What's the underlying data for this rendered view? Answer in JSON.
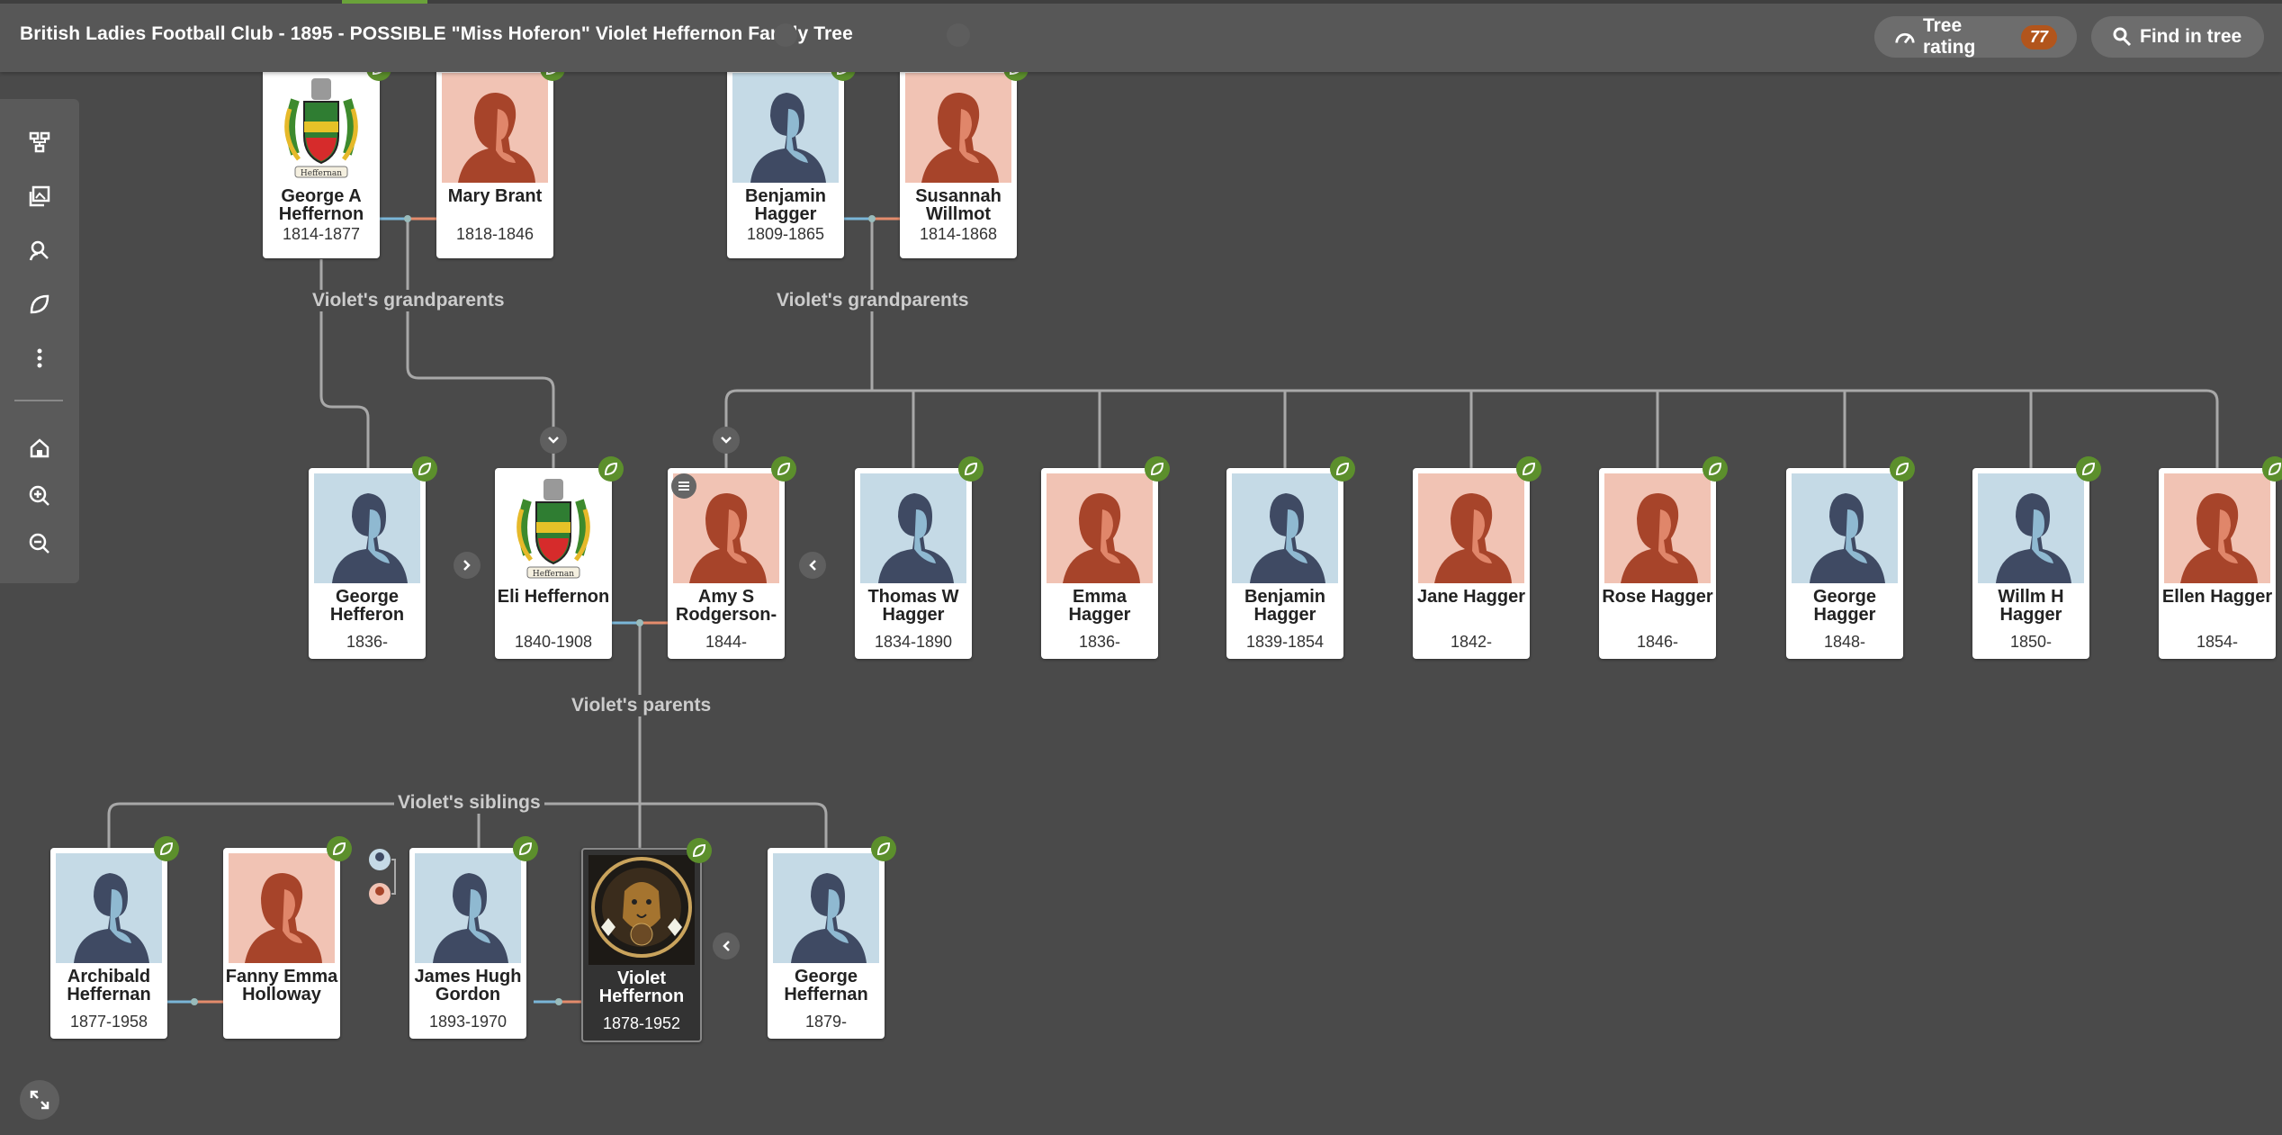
{
  "header": {
    "title": "British Ladies Football Club - 1895 - POSSIBLE \"Miss Hoferon\" Violet Heffernon Family Tree",
    "rating_label": "Tree rating",
    "rating_value": "77",
    "find_label": "Find in tree"
  },
  "toolbar": {
    "icons": [
      "tree-view-icon",
      "gallery-icon",
      "search-person-icon",
      "hint-icon",
      "more-icon",
      "home-icon",
      "zoom-in-icon",
      "zoom-out-icon"
    ]
  },
  "labels": {
    "grandparents_left": "Violet's grandparents",
    "grandparents_right": "Violet's grandparents",
    "parents": "Violet's parents",
    "siblings": "Violet's siblings"
  },
  "colors": {
    "male_bg": "#c5dae6",
    "male_fg": "#3f4a63",
    "female_bg": "#f1c3b4",
    "female_fg": "#a7442a",
    "leaf": "#5c8f2c",
    "badge": "#b2551c"
  },
  "people": [
    {
      "id": "george_a",
      "name": "George A Heffernon",
      "years": "1814-1877",
      "photo": "crest"
    },
    {
      "id": "mary",
      "name": "Mary Brant",
      "years": "1818-1846",
      "photo": "female"
    },
    {
      "id": "benjamin_s",
      "name": "Benjamin Hagger",
      "years": "1809-1865",
      "photo": "male"
    },
    {
      "id": "susannah",
      "name": "Susannah Willmot",
      "years": "1814-1868",
      "photo": "female"
    },
    {
      "id": "george_h",
      "name": "George Hefferon",
      "years": "1836-",
      "photo": "male"
    },
    {
      "id": "eli",
      "name": "Eli Heffernon",
      "years": "1840-1908",
      "photo": "crest"
    },
    {
      "id": "amy",
      "name": "Amy S Rodgerson-",
      "years": "1844-",
      "photo": "female"
    },
    {
      "id": "thomas",
      "name": "Thomas W Hagger",
      "years": "1834-1890",
      "photo": "male"
    },
    {
      "id": "emma",
      "name": "Emma Hagger",
      "years": "1836-",
      "photo": "female"
    },
    {
      "id": "benjamin_j",
      "name": "Benjamin Hagger",
      "years": "1839-1854",
      "photo": "male"
    },
    {
      "id": "jane",
      "name": "Jane Hagger",
      "years": "1842-",
      "photo": "female"
    },
    {
      "id": "rose",
      "name": "Rose Hagger",
      "years": "1846-",
      "photo": "female"
    },
    {
      "id": "george_hg",
      "name": "George Hagger",
      "years": "1848-",
      "photo": "male"
    },
    {
      "id": "willm",
      "name": "Willm H Hagger",
      "years": "1850-",
      "photo": "male"
    },
    {
      "id": "ellen",
      "name": "Ellen Hagger",
      "years": "1854-",
      "photo": "female"
    },
    {
      "id": "archibald",
      "name": "Archibald Heffernan",
      "years": "1877-1958",
      "photo": "male"
    },
    {
      "id": "fanny",
      "name": "Fanny Emma Holloway",
      "years": "",
      "photo": "female"
    },
    {
      "id": "james",
      "name": "James Hugh Gordon",
      "years": "1893-1970",
      "photo": "male"
    },
    {
      "id": "violet",
      "name": "Violet Heffernon",
      "years": "1878-1952",
      "photo": "lion",
      "focus": true
    },
    {
      "id": "george_s",
      "name": "George Heffernan",
      "years": "1879-",
      "photo": "male"
    }
  ]
}
